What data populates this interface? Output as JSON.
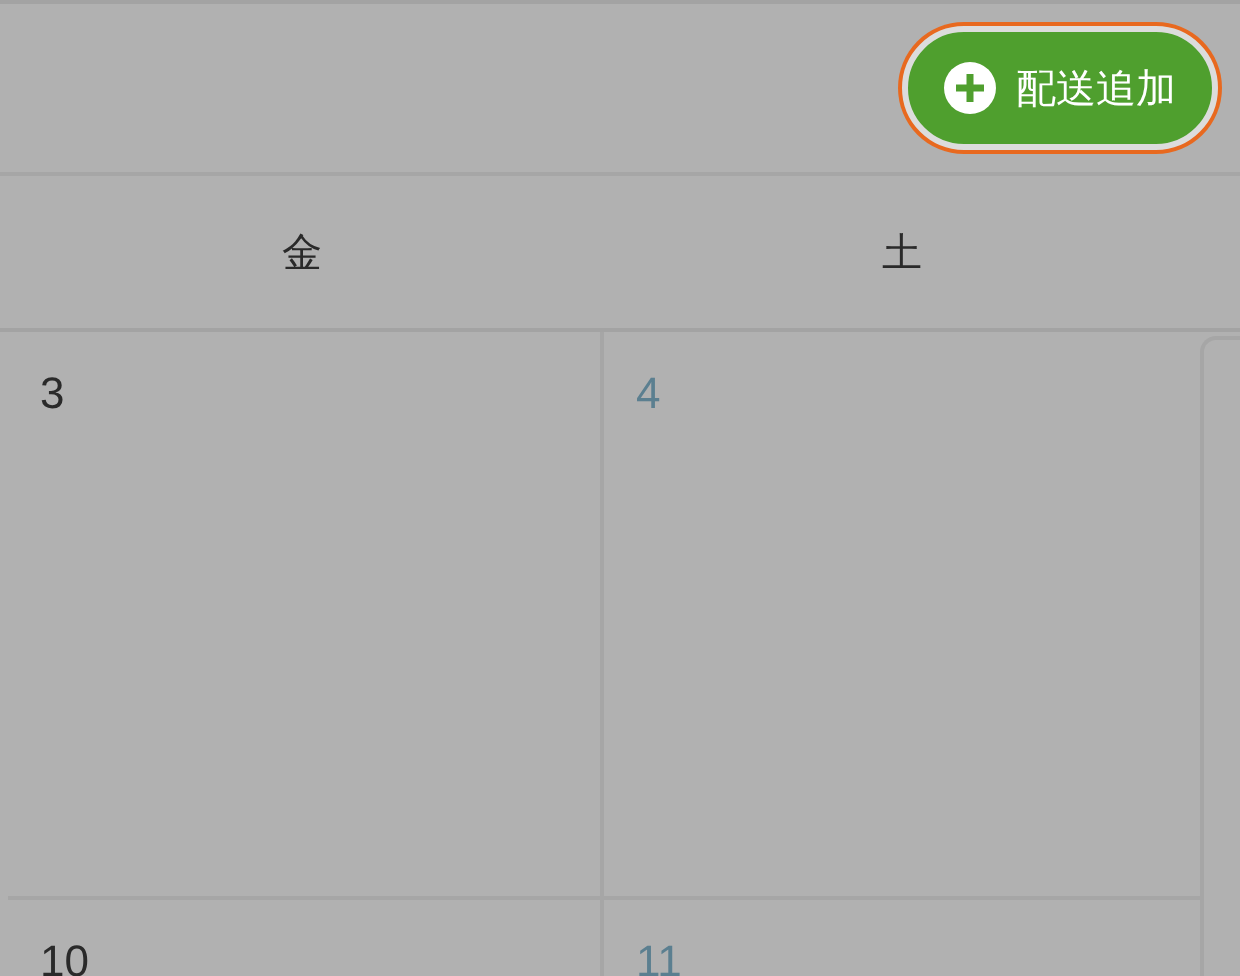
{
  "toolbar": {
    "add_button": {
      "label": "配送追加"
    }
  },
  "calendar": {
    "weekdays": [
      "金",
      "土"
    ],
    "weeks": [
      [
        {
          "day": "3",
          "kind": "weekday"
        },
        {
          "day": "4",
          "kind": "saturday"
        }
      ],
      [
        {
          "day": "10",
          "kind": "weekday"
        },
        {
          "day": "11",
          "kind": "saturday"
        }
      ]
    ]
  }
}
